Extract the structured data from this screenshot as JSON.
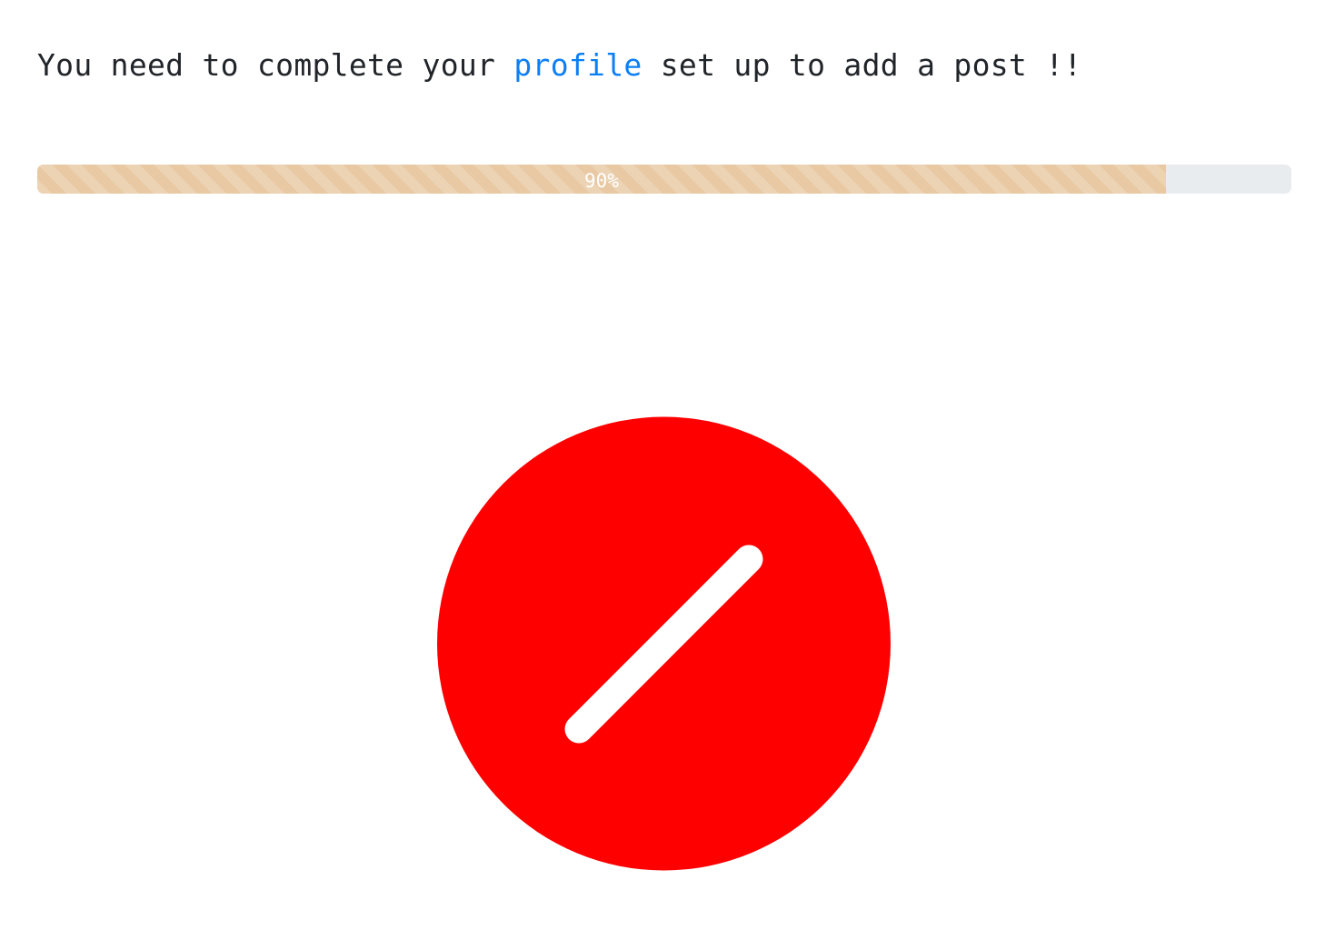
{
  "message": {
    "before": "You need to complete your",
    "link": "profile",
    "after": "set up to add a post !!"
  },
  "progress": {
    "label": "90%",
    "value": 0.9,
    "fill_color": "#e8c9a3",
    "track_color": "#e9ecef"
  },
  "status_icon": {
    "name": "blocked-icon",
    "color": "#ff0000",
    "stroke_color": "#ffffff"
  }
}
